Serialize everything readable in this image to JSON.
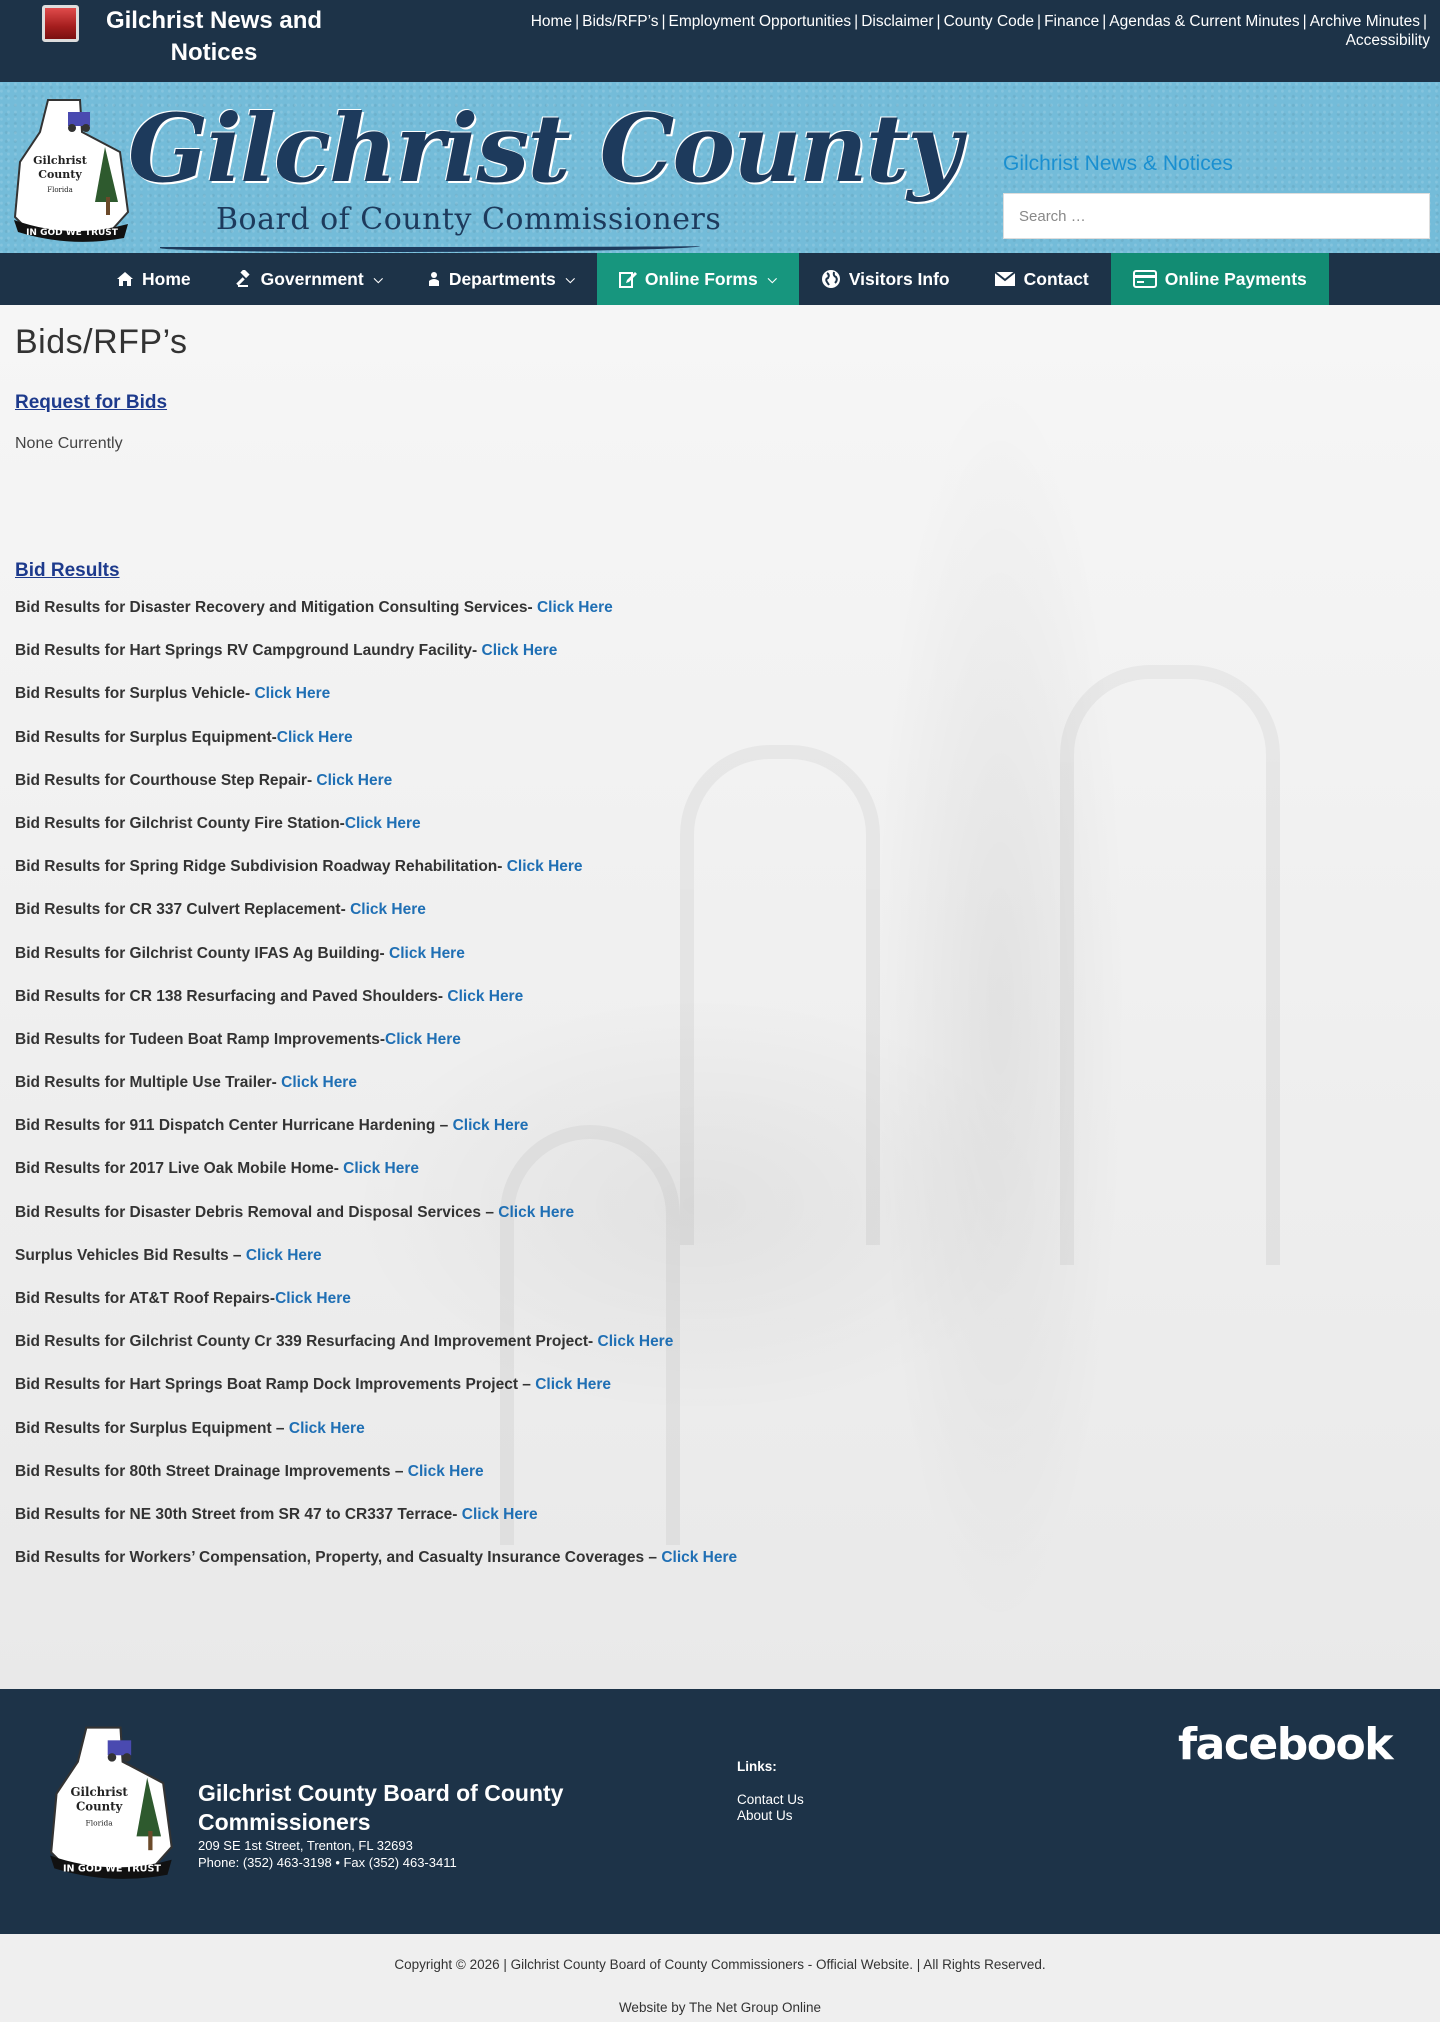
{
  "topbar": {
    "brand": "Gilchrist News and Notices",
    "links": [
      "Home",
      "Bids/RFP’s",
      "Employment Opportunities",
      "Disclaimer",
      "County Code",
      "Finance",
      "Agendas & Current Minutes",
      "Archive Minutes",
      "Accessibility"
    ]
  },
  "header": {
    "logo_title": "Gilchrist County",
    "logo_subtitle": "Board of County Commissioners",
    "seal_lines": [
      "Gilchrist",
      "County",
      "Florida",
      "IN GOD WE TRUST"
    ],
    "news_link": "Gilchrist News & Notices",
    "search_placeholder": "Search …"
  },
  "nav": {
    "items": [
      {
        "label": "Home",
        "icon": "home-icon"
      },
      {
        "label": "Government",
        "icon": "gavel-icon",
        "dropdown": true
      },
      {
        "label": "Departments",
        "icon": "person-icon",
        "dropdown": true
      },
      {
        "label": "Online Forms",
        "icon": "edit-icon",
        "dropdown": true
      },
      {
        "label": "Visitors Info",
        "icon": "globe-icon"
      },
      {
        "label": "Contact",
        "icon": "envelope-icon"
      },
      {
        "label": "Online Payments",
        "icon": "credit-card-icon"
      }
    ]
  },
  "main": {
    "title": "Bids/RFP’s",
    "request_heading": "Request for Bids",
    "request_status": "None Currently",
    "results_heading": "Bid Results",
    "link_label": "Click Here",
    "bids": [
      {
        "text": "Bid Results for Disaster Recovery and Mitigation Consulting Services- ",
        "link": "Click Here"
      },
      {
        "text": "Bid Results for Hart Springs RV Campground Laundry Facility- ",
        "link": "Click Here"
      },
      {
        "text": "Bid Results for Surplus Vehicle- ",
        "link": "Click Here"
      },
      {
        "text": "Bid Results for Surplus Equipment-",
        "link": "Click Here"
      },
      {
        "text": "Bid Results for Courthouse Step Repair- ",
        "link": "Click Here"
      },
      {
        "text": "Bid Results for Gilchrist County Fire Station-",
        "link": "Click Here"
      },
      {
        "text": "Bid Results for Spring Ridge Subdivision Roadway Rehabilitation- ",
        "link": "Click Here"
      },
      {
        "text": "Bid Results for CR 337 Culvert Replacement- ",
        "link": "Click Here"
      },
      {
        "text": "Bid Results for Gilchrist County IFAS Ag Building- ",
        "link": "Click Here"
      },
      {
        "text": "Bid Results for CR 138 Resurfacing and Paved Shoulders- ",
        "link": "Click Here"
      },
      {
        "text": "Bid Results for Tudeen Boat Ramp Improvements-",
        "link": "Click Here"
      },
      {
        "text": "Bid Results for Multiple Use Trailer- ",
        "link": "Click Here"
      },
      {
        "text": "Bid Results for 911 Dispatch Center Hurricane Hardening – ",
        "link": "Click Here"
      },
      {
        "text": "Bid Results for 2017 Live Oak Mobile Home- ",
        "link": "Click Here"
      },
      {
        "text": "Bid Results for Disaster Debris Removal and Disposal Services – ",
        "link": "Click Here"
      },
      {
        "text": "Surplus Vehicles Bid Results – ",
        "link": "Click Here"
      },
      {
        "text": "Bid Results for AT&T Roof Repairs-",
        "link": "Click Here"
      },
      {
        "text": "Bid Results for Gilchrist County Cr 339 Resurfacing And Improvement Project- ",
        "link": "Click Here"
      },
      {
        "text": "Bid Results for Hart Springs Boat Ramp Dock Improvements Project – ",
        "link": "Click Here"
      },
      {
        "text": "Bid Results for Surplus Equipment – ",
        "link": "Click Here"
      },
      {
        "text": "Bid Results for 80th Street Drainage Improvements – ",
        "link": "Click Here"
      },
      {
        "text": "Bid Results for NE 30th Street from SR 47 to CR337 Terrace- ",
        "link": "Click Here"
      },
      {
        "text": "Bid Results for Workers’ Compensation, Property, and Casualty Insurance Coverages – ",
        "link": "Click Here"
      }
    ]
  },
  "footer": {
    "org_name": "Gilchrist County Board of County Commissioners",
    "address": "209 SE 1st Street, Trenton, FL 32693",
    "phone": "Phone: (352) 463-3198 • Fax (352) 463-3411",
    "links_title": "Links:",
    "links": [
      "Contact Us",
      "About Us"
    ],
    "facebook": "facebook"
  },
  "bottom": {
    "copyright": "Copyright © 2026 | Gilchrist County Board of County Commissioners - Official Website. | All Rights Reserved.",
    "credit": "Website by The Net Group Online"
  },
  "colors": {
    "navy": "#1d3348",
    "header_blue": "#74bcd9",
    "teal": "#128c73",
    "link_blue": "#1f6fb4",
    "heading_blue": "#1d3a8c"
  }
}
